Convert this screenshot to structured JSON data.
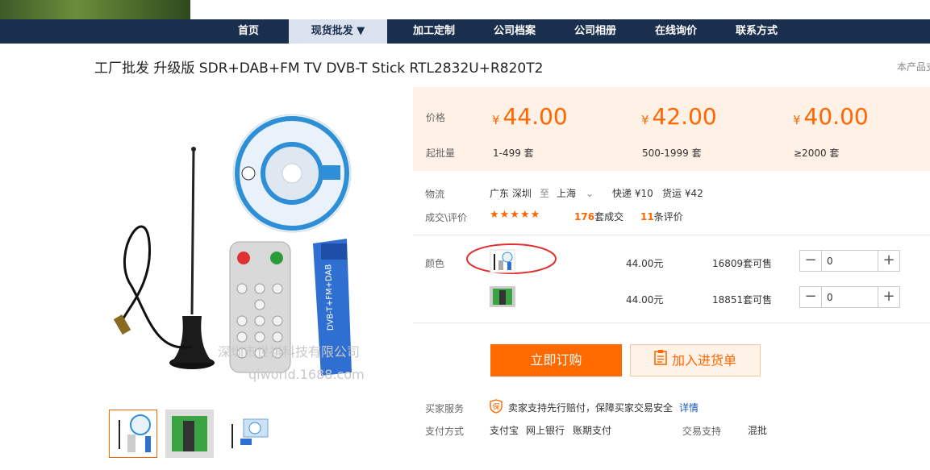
{
  "nav": {
    "items": [
      {
        "label": "首页",
        "active": false
      },
      {
        "label": "现货批发 ▼",
        "active": true
      },
      {
        "label": "加工定制",
        "active": false
      },
      {
        "label": "公司档案",
        "active": false
      },
      {
        "label": "公司相册",
        "active": false
      },
      {
        "label": "在线询价",
        "active": false
      },
      {
        "label": "联系方式",
        "active": false
      }
    ]
  },
  "product": {
    "title": "工厂批发 升级版 SDR+DAB+FM TV DVB-T Stick RTL2832U+R820T2",
    "right_note": "本产品支"
  },
  "watermark": {
    "line1": "深圳市世祺科技有限公司",
    "line2": "qiworld.1688.com"
  },
  "pricing": {
    "price_label": "价格",
    "batch_label": "起批量",
    "currency": "¥",
    "tiers": [
      {
        "price": "44.00",
        "range": "1-499 套"
      },
      {
        "price": "42.00",
        "range": "500-1999 套"
      },
      {
        "price": "40.00",
        "range": "≥2000 套"
      }
    ]
  },
  "logistics": {
    "label": "物流",
    "from": "广东 深圳",
    "to_word": "至",
    "dest": "上海",
    "express": "快递 ¥10",
    "freight": "货运 ¥42"
  },
  "reviews": {
    "label": "成交\\评价",
    "stars": "★★★★★",
    "deals_count": "176",
    "deals_suffix": "套成交",
    "reviews_count": "11",
    "reviews_suffix": "条评价"
  },
  "variants": {
    "label": "颜色",
    "rows": [
      {
        "price": "44.00元",
        "stock": "16809套可售",
        "qty": "0"
      },
      {
        "price": "44.00元",
        "stock": "18851套可售",
        "qty": "0"
      }
    ]
  },
  "actions": {
    "buy": "立即订购",
    "cart": "加入进货单"
  },
  "service": {
    "label": "买家服务",
    "badge": "保",
    "text": "卖家支持先行赔付，保障买家交易安全",
    "link": "详情"
  },
  "payment": {
    "label": "支付方式",
    "methods": [
      "支付宝",
      "网上银行",
      "账期支付"
    ],
    "trade_label": "交易支持",
    "trade_value": "混批"
  },
  "colors": {
    "accent": "#ff6a00",
    "nav_bg": "#1a2e4d",
    "price_bg": "#fff1e6",
    "highlight_ring": "#e03030"
  }
}
